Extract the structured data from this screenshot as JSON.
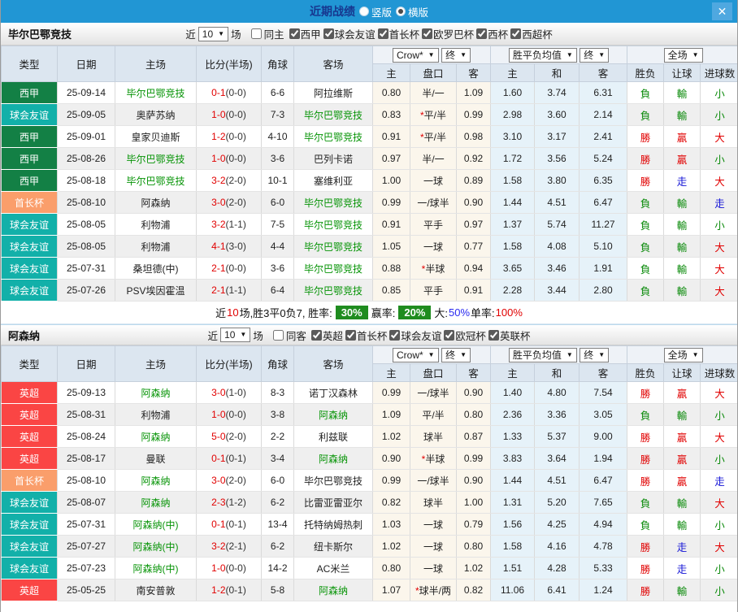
{
  "colors": {
    "accent_bar": "#2196d4",
    "close_button": "#4fa8e0",
    "title_text": "#17378f",
    "header_bg": "#dce6f0",
    "cream_col": "#fbf6ec",
    "blue_col": "#e6f2f9",
    "league_colors": {
      "西甲": "#138045",
      "球会友谊": "#12b0a9",
      "首长杯": "#fa9e6b",
      "英超": "#fa4544"
    },
    "result_colors": {
      "r": "#e10000",
      "g": "#0a8a0a",
      "b": "#1414d6"
    },
    "focus_team": "#079407",
    "score_red": "#e10000",
    "badge_green": "#1f8c1f",
    "summary_blue": "#2a2af0"
  },
  "titlebar": {
    "title": "近期战绩",
    "radio_vertical": "竖版",
    "radio_horizontal": "横版",
    "selected": "横版",
    "close_label": "X"
  },
  "sections": [
    {
      "team": "毕尔巴鄂竞技",
      "filter": {
        "near_label": "近",
        "count": "10",
        "games_label": "场",
        "same_label": "同主",
        "same_checked": false,
        "leagues": [
          "西甲",
          "球会友谊",
          "首长杯",
          "欧罗巴杯",
          "西杯",
          "西超杯"
        ]
      },
      "header": {
        "type": "类型",
        "date": "日期",
        "home": "主场",
        "score": "比分(半场)",
        "corner": "角球",
        "away": "客场",
        "odds_dropdown": "Crow*",
        "odds_final": "终",
        "odds_sub": [
          "主",
          "盘口",
          "客"
        ],
        "eu_dropdown": "胜平负均值",
        "eu_final": "终",
        "eu_sub": [
          "主",
          "和",
          "客"
        ],
        "full_dropdown": "全场",
        "result_sub": [
          "胜负",
          "让球",
          "进球数"
        ]
      },
      "rows": [
        {
          "type": "西甲",
          "date": "25-09-14",
          "home": "毕尔巴鄂竞技",
          "home_focus": true,
          "score": "0-1",
          "half": "(0-0)",
          "corner": "6-6",
          "away": "阿拉维斯",
          "away_focus": false,
          "ah": [
            "0.80",
            "半/一",
            "1.09"
          ],
          "star": false,
          "eu": [
            "1.60",
            "3.74",
            "6.31"
          ],
          "wl": [
            "負",
            "g"
          ],
          "let": [
            "輸",
            "g"
          ],
          "goal": [
            "小",
            "g"
          ]
        },
        {
          "type": "球会友谊",
          "date": "25-09-05",
          "home": "奥萨苏纳",
          "home_focus": false,
          "score": "1-0",
          "half": "(0-0)",
          "corner": "7-3",
          "away": "毕尔巴鄂竞技",
          "away_focus": true,
          "ah": [
            "0.83",
            "平/半",
            "0.99"
          ],
          "star": true,
          "eu": [
            "2.98",
            "3.60",
            "2.14"
          ],
          "wl": [
            "負",
            "g"
          ],
          "let": [
            "輸",
            "g"
          ],
          "goal": [
            "小",
            "g"
          ]
        },
        {
          "type": "西甲",
          "date": "25-09-01",
          "home": "皇家贝迪斯",
          "home_focus": false,
          "score": "1-2",
          "half": "(0-0)",
          "corner": "4-10",
          "away": "毕尔巴鄂竞技",
          "away_focus": true,
          "ah": [
            "0.91",
            "平/半",
            "0.98"
          ],
          "star": true,
          "eu": [
            "3.10",
            "3.17",
            "2.41"
          ],
          "wl": [
            "勝",
            "r"
          ],
          "let": [
            "贏",
            "r"
          ],
          "goal": [
            "大",
            "r"
          ]
        },
        {
          "type": "西甲",
          "date": "25-08-26",
          "home": "毕尔巴鄂竞技",
          "home_focus": true,
          "score": "1-0",
          "half": "(0-0)",
          "corner": "3-6",
          "away": "巴列卡诺",
          "away_focus": false,
          "ah": [
            "0.97",
            "半/一",
            "0.92"
          ],
          "star": false,
          "eu": [
            "1.72",
            "3.56",
            "5.24"
          ],
          "wl": [
            "勝",
            "r"
          ],
          "let": [
            "贏",
            "r"
          ],
          "goal": [
            "小",
            "g"
          ]
        },
        {
          "type": "西甲",
          "date": "25-08-18",
          "home": "毕尔巴鄂竞技",
          "home_focus": true,
          "score": "3-2",
          "half": "(2-0)",
          "corner": "10-1",
          "away": "塞维利亚",
          "away_focus": false,
          "ah": [
            "1.00",
            "一球",
            "0.89"
          ],
          "star": false,
          "eu": [
            "1.58",
            "3.80",
            "6.35"
          ],
          "wl": [
            "勝",
            "r"
          ],
          "let": [
            "走",
            "b"
          ],
          "goal": [
            "大",
            "r"
          ]
        },
        {
          "type": "首长杯",
          "date": "25-08-10",
          "home": "阿森纳",
          "home_focus": false,
          "score": "3-0",
          "half": "(2-0)",
          "corner": "6-0",
          "away": "毕尔巴鄂竞技",
          "away_focus": true,
          "ah": [
            "0.99",
            "一/球半",
            "0.90"
          ],
          "star": false,
          "eu": [
            "1.44",
            "4.51",
            "6.47"
          ],
          "wl": [
            "負",
            "g"
          ],
          "let": [
            "輸",
            "g"
          ],
          "goal": [
            "走",
            "b"
          ]
        },
        {
          "type": "球会友谊",
          "date": "25-08-05",
          "home": "利物浦",
          "home_focus": false,
          "score": "3-2",
          "half": "(1-1)",
          "corner": "7-5",
          "away": "毕尔巴鄂竞技",
          "away_focus": true,
          "ah": [
            "0.91",
            "平手",
            "0.97"
          ],
          "star": false,
          "eu": [
            "1.37",
            "5.74",
            "11.27"
          ],
          "wl": [
            "負",
            "g"
          ],
          "let": [
            "輸",
            "g"
          ],
          "goal": [
            "小",
            "g"
          ]
        },
        {
          "type": "球会友谊",
          "date": "25-08-05",
          "home": "利物浦",
          "home_focus": false,
          "score": "4-1",
          "half": "(3-0)",
          "corner": "4-4",
          "away": "毕尔巴鄂竞技",
          "away_focus": true,
          "ah": [
            "1.05",
            "一球",
            "0.77"
          ],
          "star": false,
          "eu": [
            "1.58",
            "4.08",
            "5.10"
          ],
          "wl": [
            "負",
            "g"
          ],
          "let": [
            "輸",
            "g"
          ],
          "goal": [
            "大",
            "r"
          ]
        },
        {
          "type": "球会友谊",
          "date": "25-07-31",
          "home": "桑坦德(中)",
          "home_focus": false,
          "score": "2-1",
          "half": "(0-0)",
          "corner": "3-6",
          "away": "毕尔巴鄂竞技",
          "away_focus": true,
          "ah": [
            "0.88",
            "半球",
            "0.94"
          ],
          "star": true,
          "eu": [
            "3.65",
            "3.46",
            "1.91"
          ],
          "wl": [
            "負",
            "g"
          ],
          "let": [
            "輸",
            "g"
          ],
          "goal": [
            "大",
            "r"
          ]
        },
        {
          "type": "球会友谊",
          "date": "25-07-26",
          "home": "PSV埃因霍温",
          "home_focus": false,
          "score": "2-1",
          "half": "(1-1)",
          "corner": "6-4",
          "away": "毕尔巴鄂竞技",
          "away_focus": true,
          "ah": [
            "0.85",
            "平手",
            "0.91"
          ],
          "star": false,
          "eu": [
            "2.28",
            "3.44",
            "2.80"
          ],
          "wl": [
            "負",
            "g"
          ],
          "let": [
            "輸",
            "g"
          ],
          "goal": [
            "大",
            "r"
          ]
        }
      ],
      "summary": [
        {
          "t": "近",
          "c": "k"
        },
        {
          "t": "10",
          "c": "r"
        },
        {
          "t": "场,胜3平0负7, 胜率:",
          "c": "k"
        },
        {
          "t": "30%",
          "badge": true
        },
        {
          "t": "赢率:",
          "c": "k"
        },
        {
          "t": "20%",
          "badge": true
        },
        {
          "t": "大:",
          "c": "k"
        },
        {
          "t": "50%",
          "c": "b"
        },
        {
          "t": " 单率:",
          "c": "k"
        },
        {
          "t": "100%",
          "c": "r"
        }
      ]
    },
    {
      "team": "阿森纳",
      "filter": {
        "near_label": "近",
        "count": "10",
        "games_label": "场",
        "same_label": "同客",
        "same_checked": false,
        "leagues": [
          "英超",
          "首长杯",
          "球会友谊",
          "欧冠杯",
          "英联杯"
        ]
      },
      "header": {
        "type": "类型",
        "date": "日期",
        "home": "主场",
        "score": "比分(半场)",
        "corner": "角球",
        "away": "客场",
        "odds_dropdown": "Crow*",
        "odds_final": "终",
        "odds_sub": [
          "主",
          "盘口",
          "客"
        ],
        "eu_dropdown": "胜平负均值",
        "eu_final": "终",
        "eu_sub": [
          "主",
          "和",
          "客"
        ],
        "full_dropdown": "全场",
        "result_sub": [
          "胜负",
          "让球",
          "进球数"
        ]
      },
      "rows": [
        {
          "type": "英超",
          "date": "25-09-13",
          "home": "阿森纳",
          "home_focus": true,
          "score": "3-0",
          "half": "(1-0)",
          "corner": "8-3",
          "away": "诺丁汉森林",
          "away_focus": false,
          "ah": [
            "0.99",
            "一/球半",
            "0.90"
          ],
          "star": false,
          "eu": [
            "1.40",
            "4.80",
            "7.54"
          ],
          "wl": [
            "勝",
            "r"
          ],
          "let": [
            "贏",
            "r"
          ],
          "goal": [
            "大",
            "r"
          ]
        },
        {
          "type": "英超",
          "date": "25-08-31",
          "home": "利物浦",
          "home_focus": false,
          "score": "1-0",
          "half": "(0-0)",
          "corner": "3-8",
          "away": "阿森纳",
          "away_focus": true,
          "ah": [
            "1.09",
            "平/半",
            "0.80"
          ],
          "star": false,
          "eu": [
            "2.36",
            "3.36",
            "3.05"
          ],
          "wl": [
            "負",
            "g"
          ],
          "let": [
            "輸",
            "g"
          ],
          "goal": [
            "小",
            "g"
          ]
        },
        {
          "type": "英超",
          "date": "25-08-24",
          "home": "阿森纳",
          "home_focus": true,
          "score": "5-0",
          "half": "(2-0)",
          "corner": "2-2",
          "away": "利兹联",
          "away_focus": false,
          "ah": [
            "1.02",
            "球半",
            "0.87"
          ],
          "star": false,
          "eu": [
            "1.33",
            "5.37",
            "9.00"
          ],
          "wl": [
            "勝",
            "r"
          ],
          "let": [
            "贏",
            "r"
          ],
          "goal": [
            "大",
            "r"
          ]
        },
        {
          "type": "英超",
          "date": "25-08-17",
          "home": "曼联",
          "home_focus": false,
          "score": "0-1",
          "half": "(0-1)",
          "corner": "3-4",
          "away": "阿森纳",
          "away_focus": true,
          "ah": [
            "0.90",
            "半球",
            "0.99"
          ],
          "star": true,
          "eu": [
            "3.83",
            "3.64",
            "1.94"
          ],
          "wl": [
            "勝",
            "r"
          ],
          "let": [
            "贏",
            "r"
          ],
          "goal": [
            "小",
            "g"
          ]
        },
        {
          "type": "首长杯",
          "date": "25-08-10",
          "home": "阿森纳",
          "home_focus": true,
          "score": "3-0",
          "half": "(2-0)",
          "corner": "6-0",
          "away": "毕尔巴鄂竞技",
          "away_focus": false,
          "ah": [
            "0.99",
            "一/球半",
            "0.90"
          ],
          "star": false,
          "eu": [
            "1.44",
            "4.51",
            "6.47"
          ],
          "wl": [
            "勝",
            "r"
          ],
          "let": [
            "贏",
            "r"
          ],
          "goal": [
            "走",
            "b"
          ]
        },
        {
          "type": "球会友谊",
          "date": "25-08-07",
          "home": "阿森纳",
          "home_focus": true,
          "score": "2-3",
          "half": "(1-2)",
          "corner": "6-2",
          "away": "比雷亚雷亚尔",
          "away_focus": false,
          "ah": [
            "0.82",
            "球半",
            "1.00"
          ],
          "star": false,
          "eu": [
            "1.31",
            "5.20",
            "7.65"
          ],
          "wl": [
            "負",
            "g"
          ],
          "let": [
            "輸",
            "g"
          ],
          "goal": [
            "大",
            "r"
          ]
        },
        {
          "type": "球会友谊",
          "date": "25-07-31",
          "home": "阿森纳(中)",
          "home_focus": true,
          "score": "0-1",
          "half": "(0-1)",
          "corner": "13-4",
          "away": "托特纳姆热刺",
          "away_focus": false,
          "ah": [
            "1.03",
            "一球",
            "0.79"
          ],
          "star": false,
          "eu": [
            "1.56",
            "4.25",
            "4.94"
          ],
          "wl": [
            "負",
            "g"
          ],
          "let": [
            "輸",
            "g"
          ],
          "goal": [
            "小",
            "g"
          ]
        },
        {
          "type": "球会友谊",
          "date": "25-07-27",
          "home": "阿森纳(中)",
          "home_focus": true,
          "score": "3-2",
          "half": "(2-1)",
          "corner": "6-2",
          "away": "纽卡斯尔",
          "away_focus": false,
          "ah": [
            "1.02",
            "一球",
            "0.80"
          ],
          "star": false,
          "eu": [
            "1.58",
            "4.16",
            "4.78"
          ],
          "wl": [
            "勝",
            "r"
          ],
          "let": [
            "走",
            "b"
          ],
          "goal": [
            "大",
            "r"
          ]
        },
        {
          "type": "球会友谊",
          "date": "25-07-23",
          "home": "阿森纳(中)",
          "home_focus": true,
          "score": "1-0",
          "half": "(0-0)",
          "corner": "14-2",
          "away": "AC米兰",
          "away_focus": false,
          "ah": [
            "0.80",
            "一球",
            "1.02"
          ],
          "star": false,
          "eu": [
            "1.51",
            "4.28",
            "5.33"
          ],
          "wl": [
            "勝",
            "r"
          ],
          "let": [
            "走",
            "b"
          ],
          "goal": [
            "小",
            "g"
          ]
        },
        {
          "type": "英超",
          "date": "25-05-25",
          "home": "南安普敦",
          "home_focus": false,
          "score": "1-2",
          "half": "(0-1)",
          "corner": "5-8",
          "away": "阿森纳",
          "away_focus": true,
          "ah": [
            "1.07",
            "球半/两",
            "0.82"
          ],
          "star": true,
          "eu": [
            "11.06",
            "6.41",
            "1.24"
          ],
          "wl": [
            "勝",
            "r"
          ],
          "let": [
            "輸",
            "g"
          ],
          "goal": [
            "小",
            "g"
          ]
        }
      ],
      "summary": null
    }
  ]
}
